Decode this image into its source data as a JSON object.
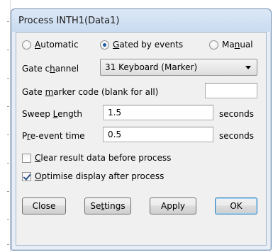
{
  "window": {
    "title": "Process INTH1(Data1)"
  },
  "mode": {
    "options": [
      {
        "pre": "",
        "u": "A",
        "post": "utomatic",
        "selected": false
      },
      {
        "pre": "",
        "u": "G",
        "post": "ated by events",
        "selected": true
      },
      {
        "pre": "Ma",
        "u": "n",
        "post": "ual",
        "selected": false
      }
    ]
  },
  "gate_channel": {
    "pre": "Gate c",
    "u": "h",
    "post": "annel",
    "value": "31 Keyboard (Marker)"
  },
  "gate_marker": {
    "pre": "Gate ",
    "u": "m",
    "post": "arker code (blank for all)",
    "value": ""
  },
  "sweep_length": {
    "pre": "Sweep ",
    "u": "L",
    "post": "ength",
    "value": "1.5",
    "unit": "seconds"
  },
  "pre_event": {
    "pre": "P",
    "u": "r",
    "post": "e-event time",
    "value": "0.5",
    "unit": "seconds"
  },
  "clear_result": {
    "pre": "",
    "u": "C",
    "post": "lear result data before process",
    "checked": false
  },
  "optimise": {
    "pre": "",
    "u": "O",
    "post": "ptimise display after process",
    "checked": true
  },
  "buttons": {
    "close": "Close",
    "settings": {
      "pre": "Se",
      "u": "t",
      "post": "tings"
    },
    "apply": "Apply",
    "ok": "OK"
  }
}
